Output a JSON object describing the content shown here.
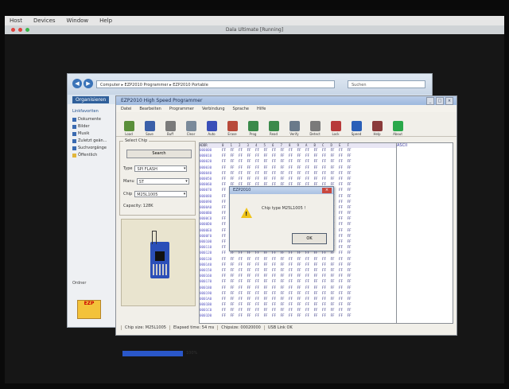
{
  "host": {
    "menu": [
      "Host",
      "Devices",
      "Window",
      "Help"
    ],
    "title": "Dala Ultimate [Running]"
  },
  "explorer": {
    "path": "Computer ▸ EZP2010 Programmer ▸ EZP2010 Portable",
    "search": "Suchen",
    "organize": "Organisieren",
    "sidebar_header": "Linkfavoriten",
    "sidebar_items": [
      "Dokumente",
      "Bilder",
      "Musik",
      "Zuletzt geän...",
      "Suchvorgänge",
      "Öffentlich"
    ],
    "bottom_label": "Ordner",
    "logo_text": "EZP"
  },
  "programmer": {
    "title": "EZP2010 High Speed Programmer",
    "menu": [
      "Datei",
      "Bearbeiten",
      "Programmer",
      "Verbindung",
      "Sprache",
      "Hilfe"
    ],
    "toolbar": [
      "Load",
      "Save",
      "Buff",
      "Clear",
      "Auto",
      "Erase",
      "Prog",
      "Read",
      "Verify",
      "Detect",
      "Lock",
      "Speed",
      "Help",
      "About"
    ],
    "select_label": "Select Chip",
    "search_btn": "Search",
    "fields": [
      {
        "label": "Type",
        "value": "SPI FLASH"
      },
      {
        "label": "Manu",
        "value": "ST"
      },
      {
        "label": "Chip",
        "value": "M25L1005"
      }
    ],
    "capacity": "Capacity: 128K",
    "progress_pct": "100%",
    "grid_header": [
      "ADDR",
      "0",
      "1",
      "2",
      "3",
      "4",
      "5",
      "6",
      "7",
      "8",
      "9",
      "A",
      "B",
      "C",
      "D",
      "E",
      "F"
    ],
    "grid_addrs": [
      "000000",
      "000010",
      "000020",
      "000030",
      "000040",
      "000050",
      "000060",
      "000070",
      "000080",
      "000090",
      "0000A0",
      "0000B0",
      "0000C0",
      "0000D0",
      "0000E0",
      "0000F0",
      "000100",
      "000110",
      "000120",
      "000130",
      "000140",
      "000150",
      "000160",
      "000170",
      "000180",
      "000190",
      "0001A0",
      "0001B0",
      "0001C0",
      "0001D0"
    ],
    "byte": "FF",
    "ascii_header": "ASCII",
    "status": [
      "Chip size: M25L1005",
      "Elapsed time: 54 ms",
      "Chipsize: 00020000",
      "USB Link OK"
    ]
  },
  "dialog": {
    "title": "EZP2010",
    "message": "Chip type M25L1005 !",
    "ok": "OK"
  }
}
